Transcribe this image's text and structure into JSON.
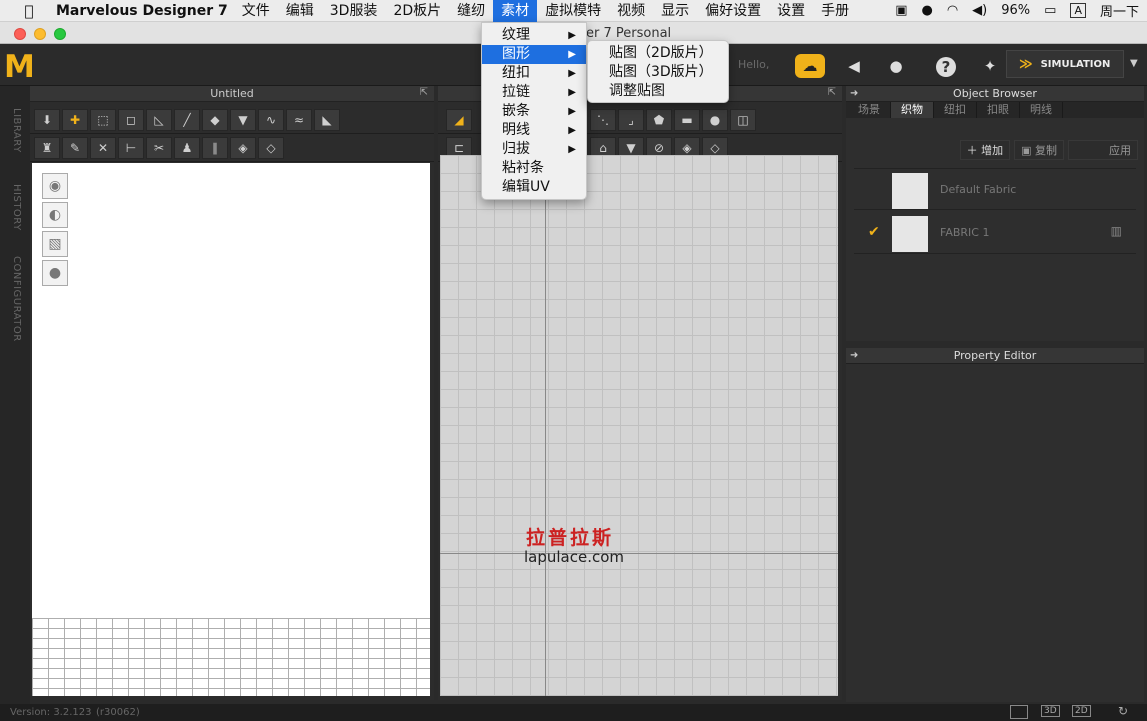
{
  "menubar": {
    "app_name": "Marvelous Designer 7",
    "items": [
      "文件",
      "编辑",
      "3D服装",
      "2D板片",
      "缝纫",
      "素材",
      "虚拟模特",
      "视频",
      "显示",
      "偏好设置",
      "设置",
      "手册"
    ],
    "active_index": 5,
    "battery": "96%",
    "input_method": "A",
    "clock": "周一下"
  },
  "window": {
    "title": "er 7 Personal"
  },
  "toolbar": {
    "hello": "Hello,",
    "simulation": "SIMULATION",
    "logo": "M"
  },
  "side_tabs": [
    "LIBRARY",
    "HISTORY",
    "CONFIGURATOR"
  ],
  "panel3d": {
    "title": "Untitled"
  },
  "menu_dropdown": {
    "items": [
      {
        "label": "纹理",
        "has_sub": true
      },
      {
        "label": "图形",
        "has_sub": true
      },
      {
        "label": "纽扣",
        "has_sub": true
      },
      {
        "label": "拉链",
        "has_sub": true
      },
      {
        "label": "嵌条",
        "has_sub": true
      },
      {
        "label": "明线",
        "has_sub": true
      },
      {
        "label": "归拔",
        "has_sub": true
      },
      {
        "label": "粘衬条",
        "has_sub": false
      },
      {
        "label": "编辑UV",
        "has_sub": false
      }
    ],
    "active_index": 1
  },
  "submenu": {
    "items": [
      "贴图（2D版片）",
      "贴图（3D版片）",
      "调整贴图"
    ]
  },
  "object_browser": {
    "title": "Object Browser",
    "tabs": [
      "场景",
      "织物",
      "纽扣",
      "扣眼",
      "明线"
    ],
    "active_tab": 1,
    "actions": {
      "add": "增加",
      "copy": "复制",
      "apply": "应用"
    },
    "fabrics": [
      {
        "name": "Default Fabric",
        "checked": false
      },
      {
        "name": "FABRIC 1",
        "checked": true
      }
    ]
  },
  "property_editor": {
    "title": "Property Editor"
  },
  "watermark": {
    "cn": "拉普拉斯",
    "url": "lapulace.com"
  },
  "status": {
    "version": "Version: 3.2.123",
    "build": "(r30062)",
    "view_buttons": [
      "3D",
      "2D"
    ]
  }
}
